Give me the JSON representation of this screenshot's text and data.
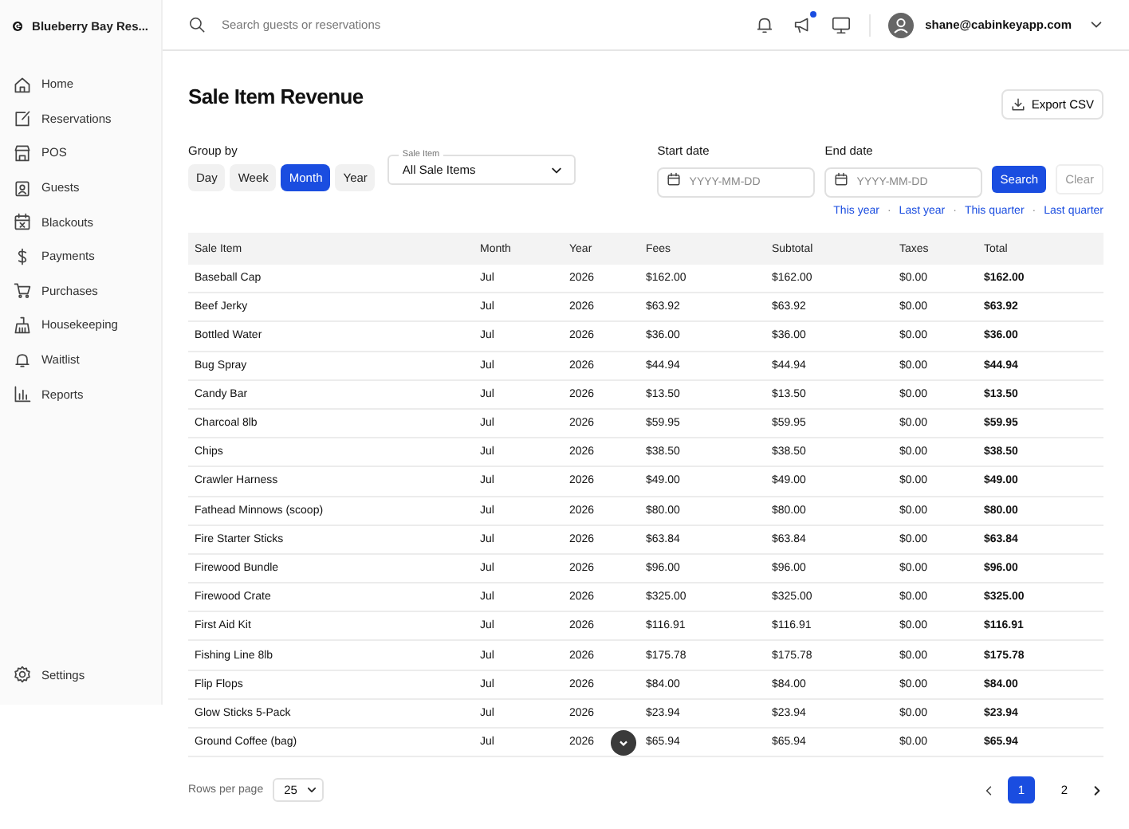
{
  "sidebar": {
    "brand": "Blueberry Bay Res...",
    "items": [
      {
        "label": "Home"
      },
      {
        "label": "Reservations"
      },
      {
        "label": "POS"
      },
      {
        "label": "Guests"
      },
      {
        "label": "Blackouts"
      },
      {
        "label": "Payments"
      },
      {
        "label": "Purchases"
      },
      {
        "label": "Housekeeping"
      },
      {
        "label": "Waitlist"
      },
      {
        "label": "Reports"
      }
    ],
    "footer": {
      "label": "Settings"
    }
  },
  "topbar": {
    "search": {
      "placeholder": "Search guests or reservations"
    },
    "announcement_unread": true,
    "user": "shane@cabinkeyapp.com"
  },
  "page": {
    "title": "Sale Item Revenue",
    "export": "Export CSV"
  },
  "filters": {
    "group_by_label": "Group by",
    "group_by": [
      {
        "label": "Day",
        "selected": false
      },
      {
        "label": "Week",
        "selected": false
      },
      {
        "label": "Month",
        "selected": true
      },
      {
        "label": "Year",
        "selected": false
      }
    ],
    "sale_item": {
      "label": "Sale Item",
      "value": "All Sale Items"
    },
    "start_date": {
      "label": "Start date",
      "placeholder": "YYYY-MM-DD"
    },
    "end_date": {
      "label": "End date",
      "placeholder": "YYYY-MM-DD"
    },
    "search": "Search",
    "clear": "Clear",
    "presets": [
      "This year",
      "Last year",
      "This quarter",
      "Last quarter"
    ],
    "separator": "·"
  },
  "table": {
    "columns": [
      "Sale Item",
      "Month",
      "Year",
      "Fees",
      "Subtotal",
      "Taxes",
      "Total"
    ],
    "rows": [
      [
        "Baseball Cap",
        "Jul",
        "2026",
        "$162.00",
        "$162.00",
        "$0.00",
        "$162.00"
      ],
      [
        "Beef Jerky",
        "Jul",
        "2026",
        "$63.92",
        "$63.92",
        "$0.00",
        "$63.92"
      ],
      [
        "Bottled Water",
        "Jul",
        "2026",
        "$36.00",
        "$36.00",
        "$0.00",
        "$36.00"
      ],
      [
        "Bug Spray",
        "Jul",
        "2026",
        "$44.94",
        "$44.94",
        "$0.00",
        "$44.94"
      ],
      [
        "Candy Bar",
        "Jul",
        "2026",
        "$13.50",
        "$13.50",
        "$0.00",
        "$13.50"
      ],
      [
        "Charcoal 8lb",
        "Jul",
        "2026",
        "$59.95",
        "$59.95",
        "$0.00",
        "$59.95"
      ],
      [
        "Chips",
        "Jul",
        "2026",
        "$38.50",
        "$38.50",
        "$0.00",
        "$38.50"
      ],
      [
        "Crawler Harness",
        "Jul",
        "2026",
        "$49.00",
        "$49.00",
        "$0.00",
        "$49.00"
      ],
      [
        "Fathead Minnows (scoop)",
        "Jul",
        "2026",
        "$80.00",
        "$80.00",
        "$0.00",
        "$80.00"
      ],
      [
        "Fire Starter Sticks",
        "Jul",
        "2026",
        "$63.84",
        "$63.84",
        "$0.00",
        "$63.84"
      ],
      [
        "Firewood Bundle",
        "Jul",
        "2026",
        "$96.00",
        "$96.00",
        "$0.00",
        "$96.00"
      ],
      [
        "Firewood Crate",
        "Jul",
        "2026",
        "$325.00",
        "$325.00",
        "$0.00",
        "$325.00"
      ],
      [
        "First Aid Kit",
        "Jul",
        "2026",
        "$116.91",
        "$116.91",
        "$0.00",
        "$116.91"
      ],
      [
        "Fishing Line 8lb",
        "Jul",
        "2026",
        "$175.78",
        "$175.78",
        "$0.00",
        "$175.78"
      ],
      [
        "Flip Flops",
        "Jul",
        "2026",
        "$84.00",
        "$84.00",
        "$0.00",
        "$84.00"
      ],
      [
        "Glow Sticks 5-Pack",
        "Jul",
        "2026",
        "$23.94",
        "$23.94",
        "$0.00",
        "$23.94"
      ],
      [
        "Ground Coffee (bag)",
        "Jul",
        "2026",
        "$65.94",
        "$65.94",
        "$0.00",
        "$65.94"
      ]
    ]
  },
  "pagination": {
    "rows_per_page_label": "Rows per page",
    "rows_per_page": "25",
    "pages": [
      {
        "label": "1",
        "selected": true
      },
      {
        "label": "2",
        "selected": false
      }
    ]
  }
}
